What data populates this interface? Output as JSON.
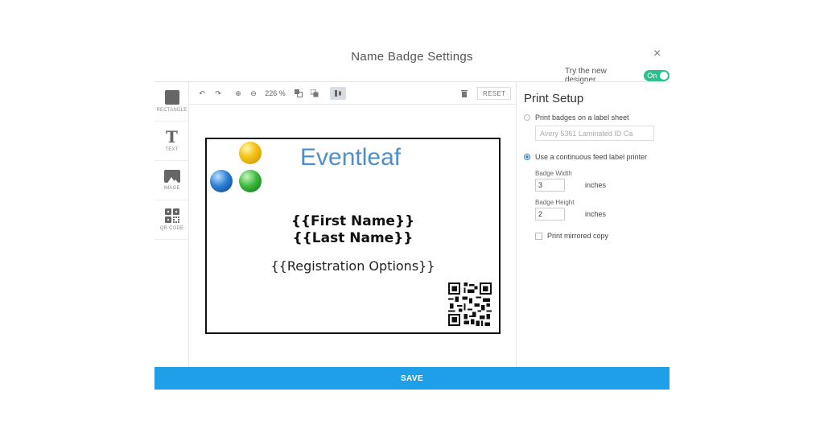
{
  "dialog": {
    "title": "Name Badge Settings",
    "close_symbol": "×"
  },
  "designer_toggle": {
    "label": "Try the new designer",
    "state": "On",
    "color": "#2dbf8f"
  },
  "tools": [
    {
      "label": "RECTANGLE",
      "icon": "rectangle-icon"
    },
    {
      "label": "TEXT",
      "icon": "text-icon"
    },
    {
      "label": "IMAGE",
      "icon": "image-icon"
    },
    {
      "label": "QR CODE",
      "icon": "qr-code-icon"
    }
  ],
  "toolbar": {
    "undo": "↶",
    "redo": "↷",
    "zoom_in": "⊕",
    "zoom_out": "⊖",
    "zoom_level": "226 %",
    "delete": "🗑",
    "reset": "RESET"
  },
  "badge": {
    "brand": "Eventleaf",
    "first_name": "{{First Name}}",
    "last_name": "{{Last Name}}",
    "registration": "{{Registration Options}}"
  },
  "print_setup": {
    "title": "Print Setup",
    "option_sheet": "Print badges on a label sheet",
    "sheet_select": "Avery 5361 Laminated ID Ca",
    "option_continuous": "Use a continuous feed label printer",
    "width_label": "Badge Width",
    "width_value": "3",
    "width_unit": "inches",
    "height_label": "Badge Height",
    "height_value": "2",
    "height_unit": "inches",
    "mirrored_label": "Print mirrored copy"
  },
  "save": {
    "label": "SAVE",
    "color": "#1f9fe8"
  }
}
